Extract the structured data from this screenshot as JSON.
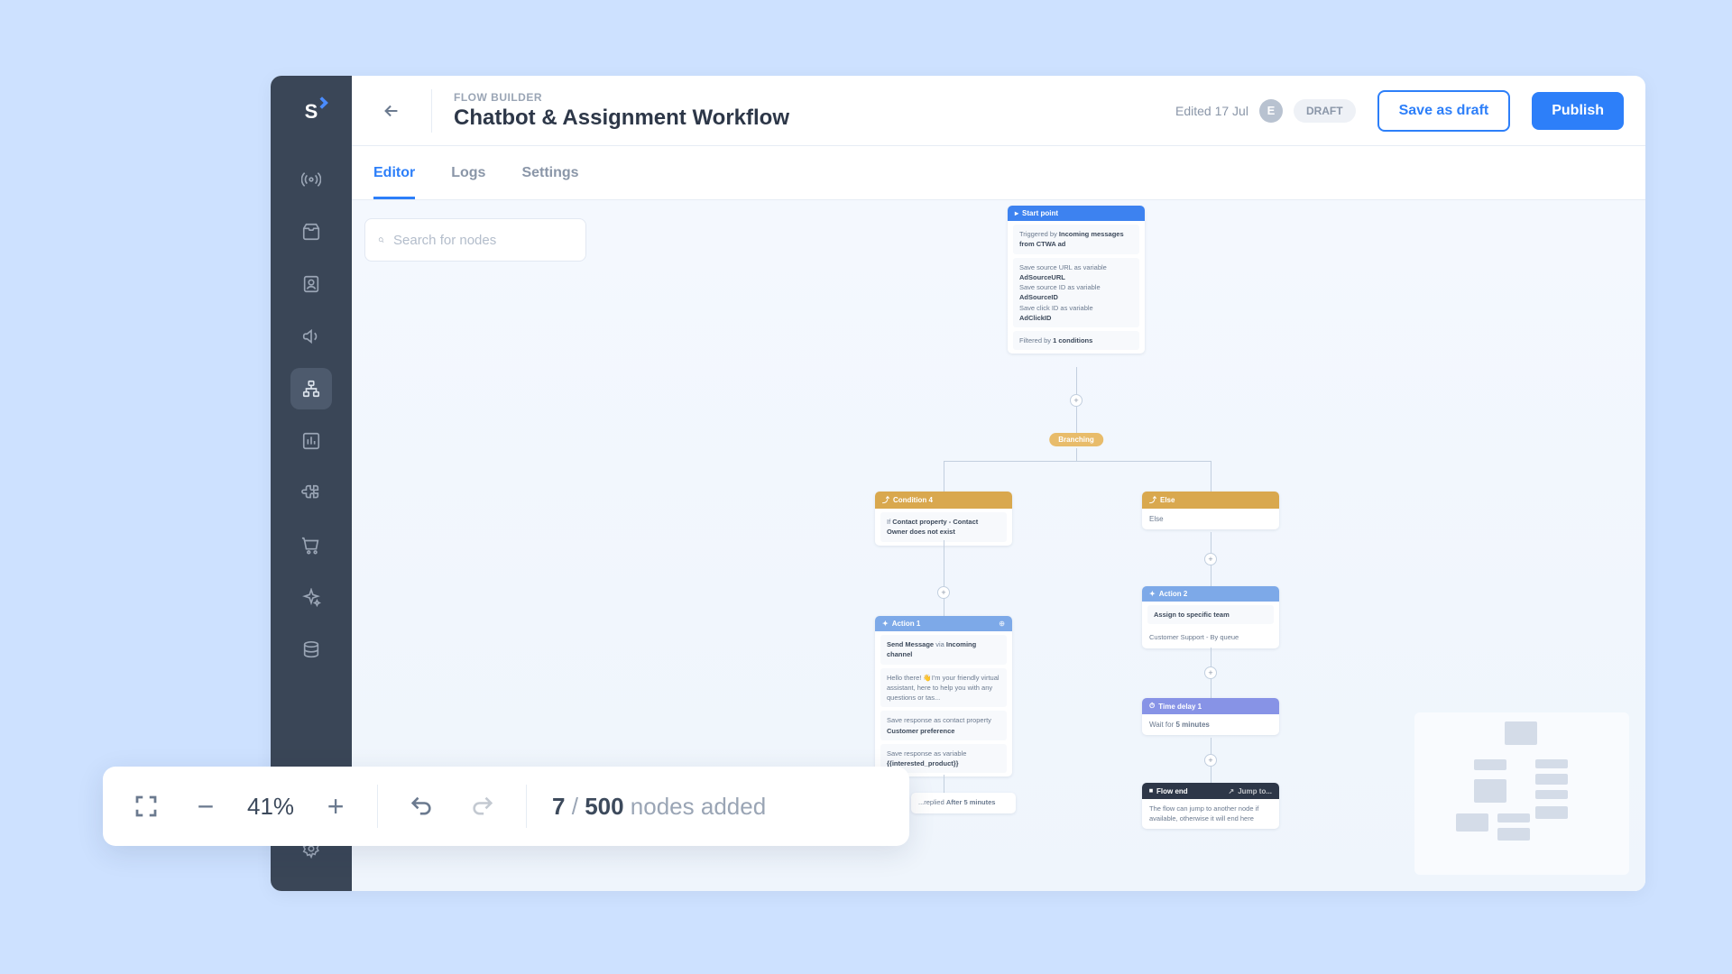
{
  "sidebar": {
    "logo": "S",
    "icons": [
      "broadcast",
      "inbox",
      "contact",
      "megaphone",
      "flow",
      "analytics",
      "puzzle",
      "cart",
      "sparkle",
      "database"
    ],
    "active_index": 4,
    "bottom_icons": [
      "add-user",
      "settings"
    ]
  },
  "header": {
    "breadcrumb": "FLOW BUILDER",
    "title": "Chatbot & Assignment Workflow",
    "edited": "Edited 17 Jul",
    "avatar_initial": "E",
    "status": "DRAFT",
    "save_draft": "Save as draft",
    "publish": "Publish"
  },
  "tabs": [
    {
      "label": "Editor",
      "active": true
    },
    {
      "label": "Logs",
      "active": false
    },
    {
      "label": "Settings",
      "active": false
    }
  ],
  "search": {
    "placeholder": "Search for nodes"
  },
  "nodes": {
    "start": {
      "title": "Start point",
      "trigger_prefix": "Triggered by",
      "trigger_bold": "Incoming messages from CTWA ad",
      "var1_prefix": "Save source URL as variable",
      "var1_bold": "AdSourceURL",
      "var2_prefix": "Save source ID as variable",
      "var2_bold": "AdSourceID",
      "var3_prefix": "Save click ID as variable",
      "var3_bold": "AdClickID",
      "filter_prefix": "Filtered by",
      "filter_bold": "1 conditions"
    },
    "branch": {
      "label": "Branching"
    },
    "condition1": {
      "title": "Condition 4",
      "text_prefix": "If",
      "text_bold": "Contact property - Contact Owner does not exist"
    },
    "else": {
      "title": "Else",
      "body": "Else"
    },
    "action1": {
      "title": "Action 1",
      "send_prefix": "Send Message",
      "send_mid": "via",
      "send_bold": "Incoming channel",
      "body2": "Hello there! 👋I'm your friendly virtual assistant, here to help you with any questions or tas...",
      "resp1_prefix": "Save response as contact property",
      "resp1_bold": "Customer preference",
      "resp2_prefix": "Save response as variable",
      "resp2_bold": "{{interested_product}}"
    },
    "action2": {
      "title": "Action 2",
      "body1": "Assign to specific team",
      "body2": "Customer Support - By queue"
    },
    "timedelay": {
      "title": "Time delay 1",
      "prefix": "Wait for",
      "bold": "5 minutes"
    },
    "flowend": {
      "title": "Flow end",
      "jump": "Jump to...",
      "body": "The flow can jump to another node if available, otherwise it will end here"
    },
    "partial_bottom": {
      "prefix": "...replied",
      "bold": "After 5 minutes"
    }
  },
  "toolbar": {
    "zoom": "41%",
    "count_current": "7",
    "count_sep": " / ",
    "count_max": "500",
    "count_label": " nodes added"
  }
}
